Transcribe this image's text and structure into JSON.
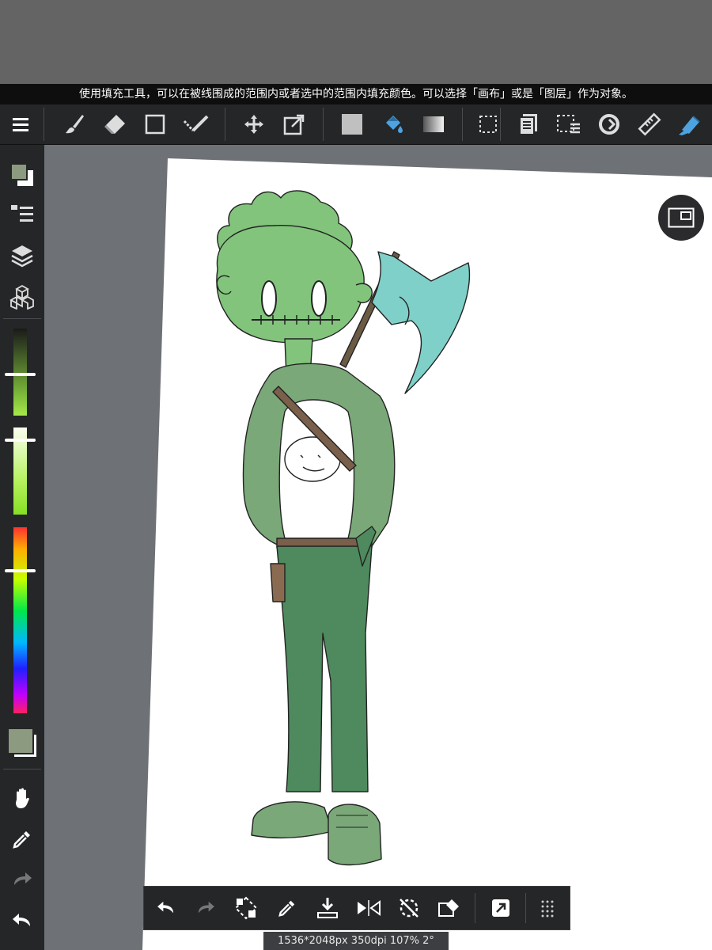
{
  "hint": {
    "text": "使用填充工具，可以在被线围成的范围内或者选中的范围内填充颜色。可以选择「画布」或是「图层」作为对象。"
  },
  "toolbar": {
    "tools": [
      {
        "name": "menu-icon",
        "active": false
      },
      {
        "name": "brush-icon",
        "active": false
      },
      {
        "name": "eraser-icon",
        "active": false
      },
      {
        "name": "shape-icon",
        "active": false
      },
      {
        "name": "select-pen-icon",
        "active": false
      },
      {
        "name": "move-icon",
        "active": false
      },
      {
        "name": "transform-icon",
        "active": false
      },
      {
        "name": "fill-color-icon",
        "active": false
      },
      {
        "name": "bucket-icon",
        "active": true
      },
      {
        "name": "gradient-icon",
        "active": false
      },
      {
        "name": "selection-icon",
        "active": false
      },
      {
        "name": "pages-icon",
        "active": false
      },
      {
        "name": "select-menu-icon",
        "active": false
      },
      {
        "name": "snap-icon",
        "active": false
      },
      {
        "name": "ruler-icon",
        "active": false
      },
      {
        "name": "fill-tool-icon",
        "active": false
      }
    ]
  },
  "sidebar": {
    "tools": [
      "color-swatch-icon",
      "brush-list-icon",
      "layers-icon",
      "materials-icon"
    ],
    "bottom_tools": [
      "hand-icon",
      "eyedropper-icon",
      "redo-icon",
      "undo-icon"
    ],
    "brightness_level": 0.62,
    "size_level": 0.1,
    "hue_level": 0.24,
    "foreground_color": "#8c9a80"
  },
  "bottom_bar": {
    "tools": [
      "undo-icon",
      "redo-icon",
      "transform-icon",
      "eyedropper-icon",
      "save-icon",
      "flip-icon",
      "rotate-reset-icon",
      "clear-icon",
      "share-icon",
      "grid-icon"
    ]
  },
  "status": {
    "text": "1536*2048px 350dpi 107% 2°"
  },
  "colors": {
    "accent": "#4da3e0",
    "skin": "#82c47c",
    "hoodie": "#7aa878",
    "pants": "#4e8a5e",
    "axe_blade": "#7fd0c8"
  }
}
